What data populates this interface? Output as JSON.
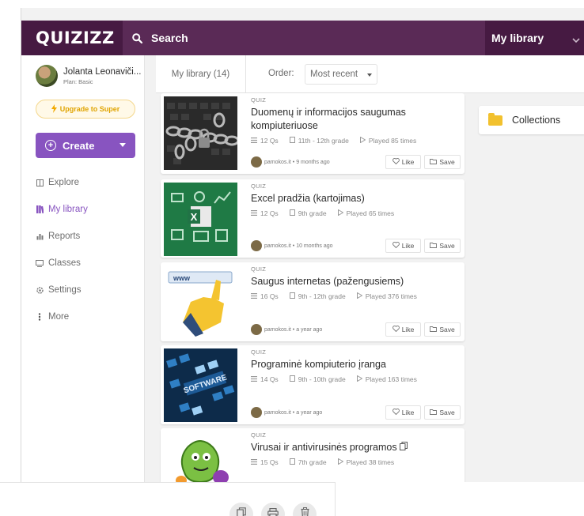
{
  "brand": {
    "logo": "QUIZIZZ",
    "accent": "#8854c0",
    "topbar_color": "#461a42"
  },
  "search": {
    "label": "Search"
  },
  "library_select": {
    "value": "My library"
  },
  "user": {
    "name": "Jolanta Leonaviči...",
    "plan": "Plan: Basic"
  },
  "sidebar": {
    "upgrade_label": "Upgrade to Super",
    "create_label": "Create",
    "items": [
      {
        "label": "Explore",
        "icon": "explore-icon",
        "active": false
      },
      {
        "label": "My library",
        "icon": "library-icon",
        "active": true
      },
      {
        "label": "Reports",
        "icon": "reports-icon",
        "active": false
      },
      {
        "label": "Classes",
        "icon": "classes-icon",
        "active": false
      },
      {
        "label": "Settings",
        "icon": "settings-icon",
        "active": false
      },
      {
        "label": "More",
        "icon": "more-icon",
        "active": false
      }
    ]
  },
  "library": {
    "tab_label": "My library (14)",
    "order_label": "Order:",
    "order_value": "Most recent",
    "collections_label": "Collections"
  },
  "quizzes": [
    {
      "type": "QUIZ",
      "title": "Duomenų ir informacijos saugumas kompiuteriuose",
      "questions": "12 Qs",
      "grade": "11th - 12th grade",
      "played": "Played 85 times",
      "author": "pamokos.it • 9 months ago"
    },
    {
      "type": "QUIZ",
      "title": "Excel pradžia (kartojimas)",
      "questions": "12 Qs",
      "grade": "9th grade",
      "played": "Played 65 times",
      "author": "pamokos.it • 10 months ago"
    },
    {
      "type": "QUIZ",
      "title": "Saugus internetas (pažengusiems)",
      "questions": "16 Qs",
      "grade": "9th - 12th grade",
      "played": "Played 376 times",
      "author": "pamokos.it • a year ago"
    },
    {
      "type": "QUIZ",
      "title": "Programinė kompiuterio įranga",
      "questions": "14 Qs",
      "grade": "9th - 10th grade",
      "played": "Played 163 times",
      "author": "pamokos.it • a year ago"
    },
    {
      "type": "QUIZ",
      "title": "Virusai ir antivirusinės programos",
      "questions": "15 Qs",
      "grade": "7th grade",
      "played": "Played 38 times",
      "author": ""
    }
  ],
  "actions": {
    "like": "Like",
    "save": "Save"
  }
}
